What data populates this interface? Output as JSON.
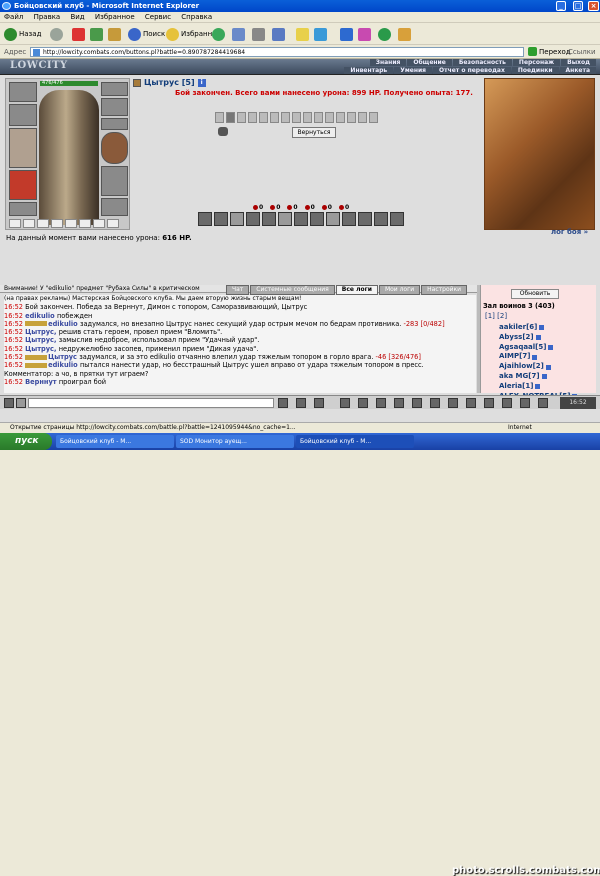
{
  "window": {
    "title": "Бойцовский клуб - Microsoft Internet Explorer"
  },
  "menu": [
    "Файл",
    "Правка",
    "Вид",
    "Избранное",
    "Сервис",
    "Справка"
  ],
  "toolbar": {
    "back": "Назад",
    "search": "Поиск",
    "favorites": "Избранное"
  },
  "address": {
    "label": "Адрес",
    "url": "http://lowcity.combats.com/buttons.pl?battle=0.890787284419684",
    "go": "Переход",
    "links": "Ссылки"
  },
  "header": {
    "logo": "LOWCITY",
    "nav_top": [
      "Знания",
      "Общение",
      "Безопасность",
      "Персонаж",
      "Выход"
    ],
    "nav_bottom": [
      "Инвентарь",
      "Умения",
      "Отчет о переводах",
      "Поединки",
      "Анкета"
    ]
  },
  "character": {
    "name": "Цытрус [5]",
    "hp_text": "476/476"
  },
  "fight": {
    "result": "Бой закончен. Всего вами нанесено урона: 899 HP. Получено опыта: 177.",
    "back_button": "Вернуться",
    "damage_label": "На данный момент вами нанесено урона:",
    "damage_value": "616 HP.",
    "log_link": "лог боя »",
    "counters": [
      "0",
      "0",
      "0",
      "0",
      "0",
      "0"
    ]
  },
  "chat": {
    "notice_prefix": "Внимание! У \"edikulio\" предмет \"Рубаха Силы\" в критическом",
    "notice_adv": "(на правах рекламы) Мастерская Бойцовского клуба. Мы даем вторую жизнь старым вещам!",
    "tabs": [
      "Чат",
      "Системные сообщения",
      "Все логи",
      "Мои логи",
      "Настройки"
    ],
    "lines": [
      {
        "time": "16:52",
        "text": "Бой закончен. Победа за Верннут, Димон с топором, Саморазвивающий, Цытрус"
      },
      {
        "time": "16:52",
        "player": "edikulio",
        "text": "побежден"
      },
      {
        "time": "16:52",
        "mark": true,
        "player": "edikulio",
        "text": "задумался, но внезапно Цытрус нанес секущий удар острым мечом по бедрам противника.",
        "hit": "-283 [0/482]"
      },
      {
        "time": "16:52",
        "player": "Цытрус,",
        "text": "решив стать героем, провел прием \"Вломить\"."
      },
      {
        "time": "16:52",
        "player": "Цытрус,",
        "text": "замыслив недоброе, использовал прием \"Удачный удар\"."
      },
      {
        "time": "16:52",
        "player": "Цытрус,",
        "text": "недружелюбно засопев, применил прием \"Дикая удача\"."
      },
      {
        "time": "16:52",
        "mark": true,
        "player": "Цытрус",
        "text": "задумался, и за это edikulio отчаянно влепил удар тяжелым топором в горло врага.",
        "hit": "-46 [326/476]"
      },
      {
        "time": "16:52",
        "mark": true,
        "player": "edikulio",
        "text": "пытался нанести удар, но бесстрашный Цытрус ушел вправо от удара тяжелым топором в пресс."
      },
      {
        "time": "",
        "text": "Комментатор: а чо, в прятки тут играем?"
      },
      {
        "time": "16:52",
        "player": "Верннут",
        "text": "проиграл бой"
      }
    ]
  },
  "online": {
    "update_button": "Обновить",
    "heading": "Зал воинов 3 (403)",
    "pages": "[1] [2]",
    "players": [
      "aakiler[6]",
      "Abyss[2]",
      "Agsaqaal[5]",
      "AIMP[7]",
      "Ajaihlow[2]",
      "aka MG[7]",
      "Aleria[1]",
      "ALEX_NOTREAL[5]"
    ]
  },
  "bottom": {
    "clock": "16:52"
  },
  "statusbar": {
    "text": "Открытие страницы http://lowcity.combats.com/battle.pl?battle=1241095944&no_cache=1...",
    "zone": "Internet"
  },
  "taskbar": {
    "start": "пуск",
    "tasks": [
      "Бойцовский клуб - М...",
      "SOD Монитор ауещ...",
      "Бойцовский клуб - М..."
    ]
  },
  "watermark": "photo.scrolls.combats.com"
}
